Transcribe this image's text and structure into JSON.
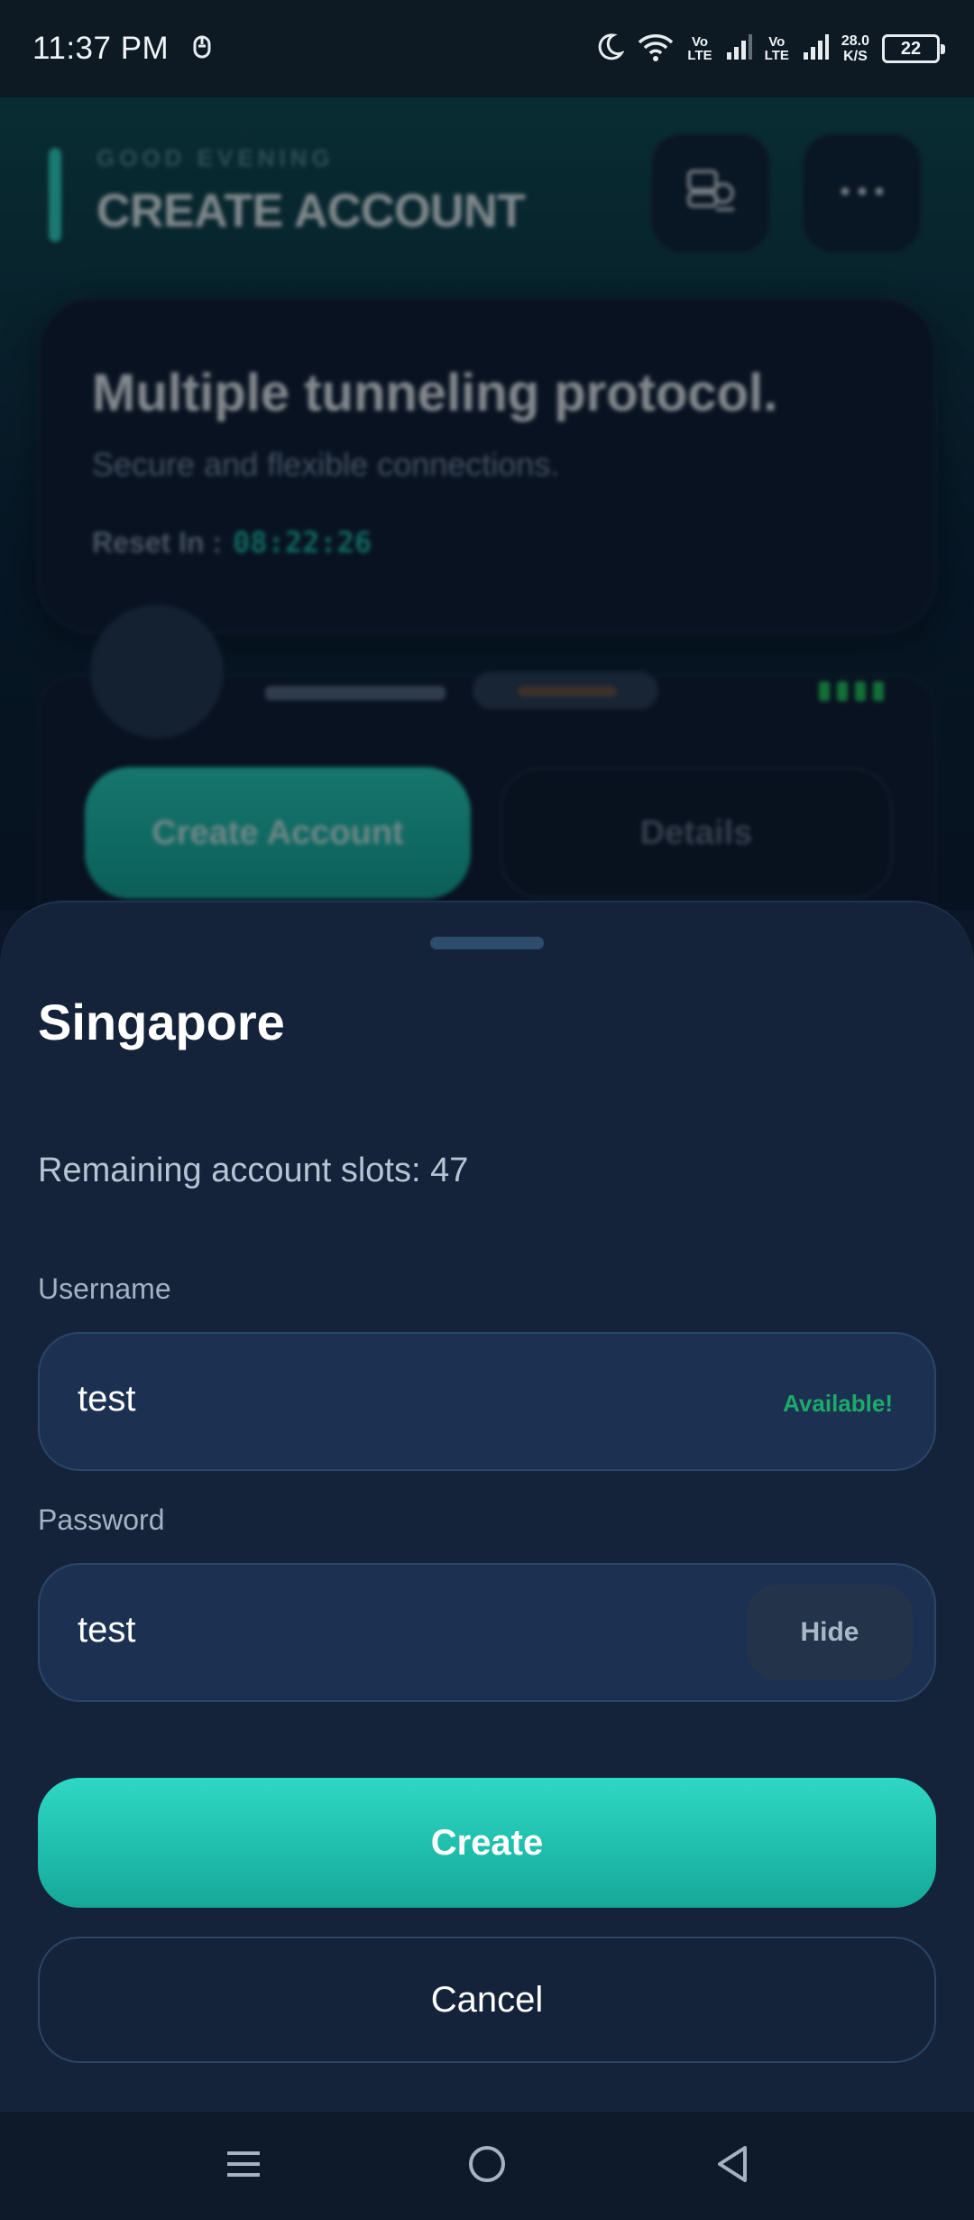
{
  "status_bar": {
    "time": "11:37 PM",
    "volte_1": "Vo\nLTE",
    "volte_2": "Vo\nLTE",
    "net_speed_value": "28.0",
    "net_speed_unit": "K/S",
    "battery": "22"
  },
  "background_app": {
    "greeting": "GOOD EVENING",
    "title": "CREATE ACCOUNT",
    "banner": {
      "title": "Multiple tunneling protocol.",
      "subtitle": "Secure and flexible connections.",
      "reset_label": "Reset In :",
      "reset_timer": "08:22:26"
    },
    "server_card": {
      "create_button": "Create Account",
      "details_button": "Details"
    }
  },
  "sheet": {
    "title": "Singapore",
    "slots_text": "Remaining account slots: 47",
    "username": {
      "label": "Username",
      "value": "test",
      "status": "Available!"
    },
    "password": {
      "label": "Password",
      "value": "test",
      "toggle_label": "Hide"
    },
    "create_button": "Create",
    "cancel_button": "Cancel"
  },
  "colors": {
    "accent": "#2ed6c0",
    "available": "#1ea86b",
    "sheet_bg": "#15233a"
  },
  "icons": {
    "status": [
      "dnd-moon-icon",
      "wifi-icon",
      "signal-icon",
      "signal-icon",
      "battery-icon"
    ],
    "nav": [
      "recents-icon",
      "home-icon",
      "back-icon"
    ]
  }
}
